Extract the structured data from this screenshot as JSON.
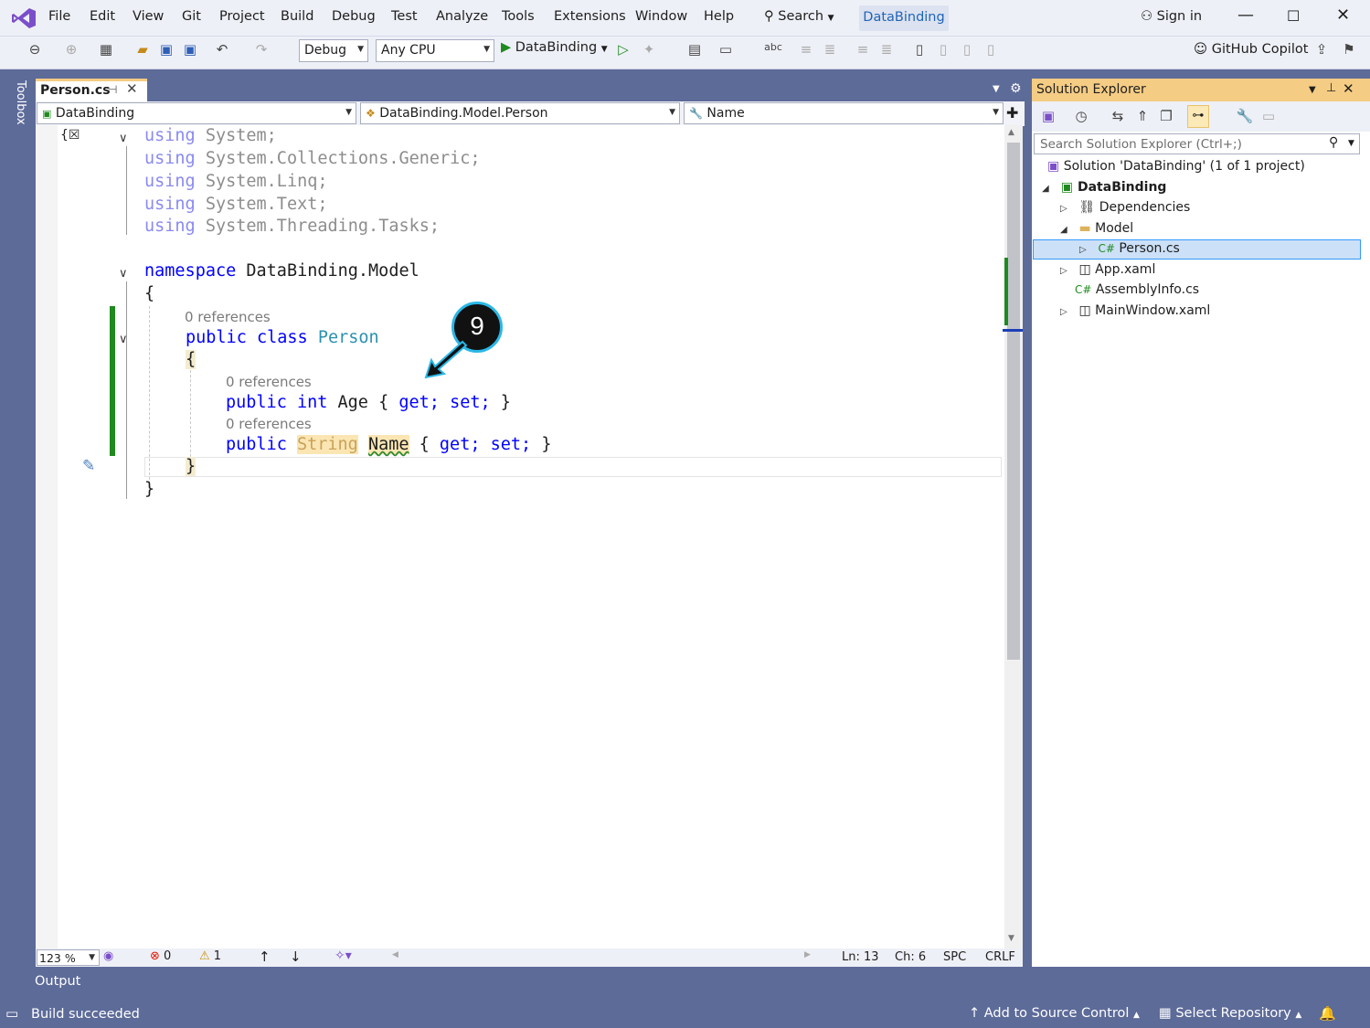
{
  "menu": {
    "items": [
      "File",
      "Edit",
      "View",
      "Git",
      "Project",
      "Build",
      "Debug",
      "Test",
      "Analyze",
      "Tools",
      "Extensions",
      "Window",
      "Help"
    ],
    "search_label": "Search",
    "solution_name": "DataBinding",
    "sign_in": "Sign in"
  },
  "toolbar": {
    "config": "Debug",
    "platform": "Any CPU",
    "run_target": "DataBinding",
    "copilot": "GitHub Copilot"
  },
  "toolbox": {
    "label": "Toolbox"
  },
  "doc_tab": {
    "title": "Person.cs"
  },
  "navbar": {
    "project": "DataBinding",
    "type": "DataBinding.Model.Person",
    "member": "Name"
  },
  "code": {
    "usings": [
      {
        "kw": "using",
        "ns": "System;"
      },
      {
        "kw": "using",
        "ns": "System.Collections.Generic;"
      },
      {
        "kw": "using",
        "ns": "System.Linq;"
      },
      {
        "kw": "using",
        "ns": "System.Text;"
      },
      {
        "kw": "using",
        "ns": "System.Threading.Tasks;"
      }
    ],
    "namespace_kw": "namespace",
    "namespace_name": "DataBinding.Model",
    "open_brace": "{",
    "close_brace": "}",
    "refs_class": "0 references",
    "class_public": "public",
    "class_kw": "class",
    "class_name": "Person",
    "refs_age": "0 references",
    "age_public": "public",
    "age_type": "int",
    "age_name": "Age",
    "refs_name": "0 references",
    "name_public": "public",
    "name_type": "String",
    "name_name": "Name",
    "brace_l": "{",
    "brace_r": "}",
    "get": "get;",
    "set": "set;"
  },
  "annotation": {
    "number": "9"
  },
  "editor_status": {
    "zoom": "123 %",
    "errors": "0",
    "warnings": "1",
    "line": "Ln: 13",
    "col": "Ch: 6",
    "spacing": "SPC",
    "eol": "CRLF"
  },
  "solution_explorer": {
    "title": "Solution Explorer",
    "search_placeholder": "Search Solution Explorer (Ctrl+;)",
    "items": [
      {
        "label": "Solution 'DataBinding' (1 of 1 project)"
      },
      {
        "label": "DataBinding"
      },
      {
        "label": "Dependencies"
      },
      {
        "label": "Model"
      },
      {
        "label": "Person.cs"
      },
      {
        "label": "App.xaml"
      },
      {
        "label": "AssemblyInfo.cs"
      },
      {
        "label": "MainWindow.xaml"
      }
    ]
  },
  "output": {
    "tab": "Output"
  },
  "statusbar": {
    "build": "Build succeeded",
    "source_control": "Add to Source Control",
    "repo": "Select Repository"
  },
  "colors": {
    "accent": "#5d6b99",
    "keyword": "#0000ff",
    "type": "#2b91af",
    "tab_active": "#f5cc84",
    "change_bar": "#1f8a1f"
  }
}
